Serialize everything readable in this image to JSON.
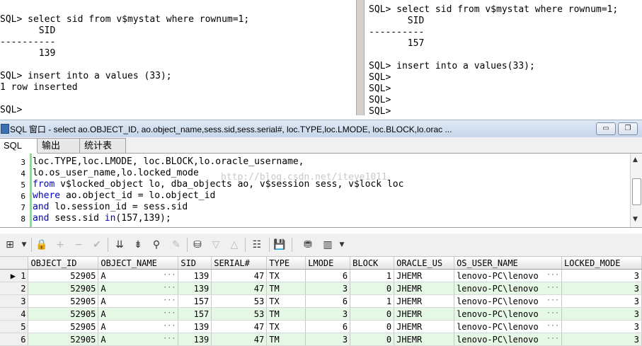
{
  "left_pane": {
    "lines": [
      "SQL> select sid from v$mystat where rownum=1;",
      "       SID",
      "----------",
      "       139",
      "",
      "SQL> insert into a values (33);",
      "1 row inserted",
      "",
      "SQL>"
    ]
  },
  "right_pane": {
    "lines": [
      "SQL> select sid from v$mystat where rownum=1;",
      "       SID",
      "----------",
      "       157",
      "",
      "SQL> insert into a values(33);",
      "SQL>",
      "SQL>",
      "SQL>",
      "SQL>"
    ]
  },
  "window": {
    "title": "SQL 窗口 - select ao.OBJECT_ID, ao.object_name,sess.sid,sess.serial#, loc.TYPE,loc.LMODE, loc.BLOCK,lo.orac ...",
    "minimize": "▭",
    "restore": "❐"
  },
  "tabs": [
    "SQL",
    "输出",
    "统计表"
  ],
  "editor": {
    "line_numbers": [
      "3",
      "4",
      "5",
      "6",
      "7",
      "8"
    ],
    "lines": [
      [
        {
          "t": "loc.TYPE,loc.LMODE, loc.BLOCK,lo.oracle_username,",
          "k": false
        }
      ],
      [
        {
          "t": "lo.os_user_name,lo.locked_mode",
          "k": false
        }
      ],
      [
        {
          "t": "from",
          "k": true
        },
        {
          "t": " v$locked_object lo, dba_objects ao, v$session sess, v$lock loc",
          "k": false
        }
      ],
      [
        {
          "t": "where",
          "k": true
        },
        {
          "t": " ao.object_id = lo.object_id",
          "k": false
        }
      ],
      [
        {
          "t": "and",
          "k": true
        },
        {
          "t": " lo.session_id = sess.sid",
          "k": false
        }
      ],
      [
        {
          "t": "and",
          "k": true
        },
        {
          "t": " sess.sid ",
          "k": false
        },
        {
          "t": "in",
          "k": true
        },
        {
          "t": "(157,139);",
          "k": false
        }
      ]
    ],
    "watermark": "http://blog.csdn.net/iteye1011"
  },
  "grid": {
    "columns": [
      "OBJECT_ID",
      "OBJECT_NAME",
      "SID",
      "SERIAL#",
      "TYPE",
      "LMODE",
      "BLOCK",
      "ORACLE_US",
      "OS_USER_NAME",
      "LOCKED_MODE"
    ],
    "rows": [
      [
        "1",
        "52905",
        "A",
        "139",
        "47",
        "TX",
        "6",
        "1",
        "JHEMR",
        "lenovo-PC\\lenovo",
        "3"
      ],
      [
        "2",
        "52905",
        "A",
        "139",
        "47",
        "TM",
        "3",
        "0",
        "JHEMR",
        "lenovo-PC\\lenovo",
        "3"
      ],
      [
        "3",
        "52905",
        "A",
        "157",
        "53",
        "TX",
        "6",
        "1",
        "JHEMR",
        "lenovo-PC\\lenovo",
        "3"
      ],
      [
        "4",
        "52905",
        "A",
        "157",
        "53",
        "TM",
        "3",
        "0",
        "JHEMR",
        "lenovo-PC\\lenovo",
        "3"
      ],
      [
        "5",
        "52905",
        "A",
        "139",
        "47",
        "TX",
        "6",
        "0",
        "JHEMR",
        "lenovo-PC\\lenovo",
        "3"
      ],
      [
        "6",
        "52905",
        "A",
        "139",
        "47",
        "TM",
        "3",
        "0",
        "JHEMR",
        "lenovo-PC\\lenovo",
        "3"
      ]
    ]
  }
}
